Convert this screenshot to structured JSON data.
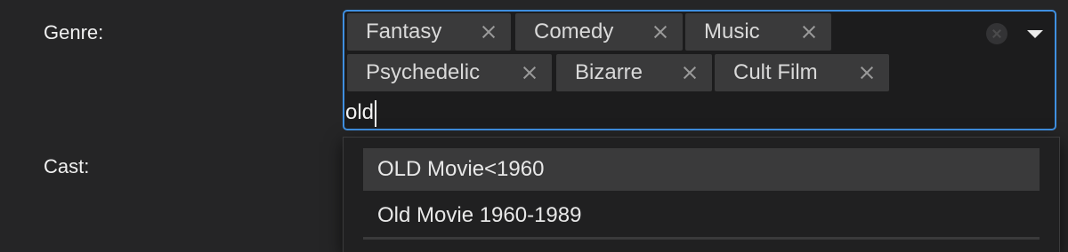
{
  "form": {
    "genre_label": "Genre:",
    "cast_label": "Cast:"
  },
  "genre_select": {
    "selected_tags": [
      {
        "label": "Fantasy"
      },
      {
        "label": "Comedy"
      },
      {
        "label": "Music"
      },
      {
        "label": "Psychedelic"
      },
      {
        "label": "Bizarre"
      },
      {
        "label": "Cult Film"
      }
    ],
    "search_value": "old",
    "options": [
      {
        "label": "OLD Movie<1960",
        "highlighted": true
      },
      {
        "label": "Old Movie 1960-1989",
        "highlighted": false
      }
    ]
  },
  "colors": {
    "background": "#252526",
    "focus_border": "#3f8fe0",
    "tag_background": "#3a3a3b",
    "option_highlight": "#3a3a3b"
  },
  "icons": {
    "tag_remove": "close-icon",
    "clear_all": "clear-circle-icon",
    "dropdown": "triangle-down-icon"
  }
}
